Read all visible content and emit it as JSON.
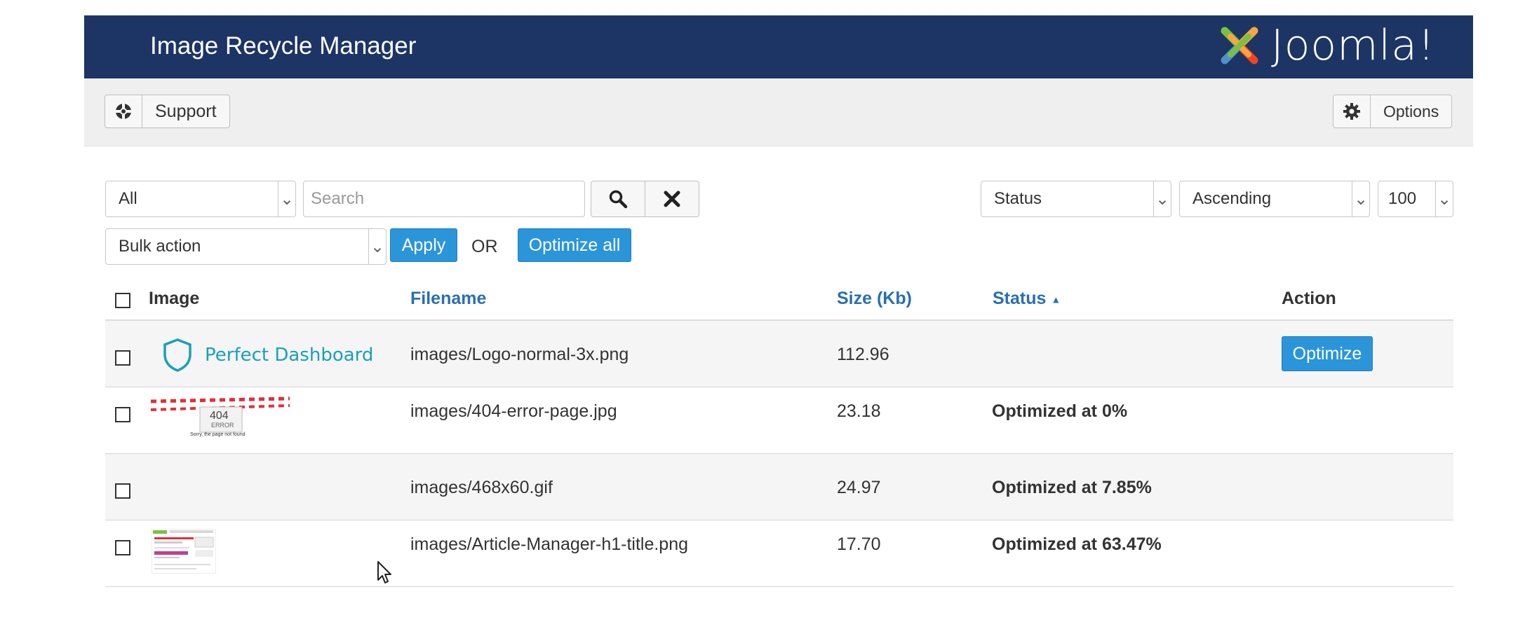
{
  "header": {
    "title": "Image Recycle Manager",
    "brand": "Joomla!"
  },
  "toolbar": {
    "support_label": "Support",
    "options_label": "Options"
  },
  "filters": {
    "type_select": "All",
    "search_placeholder": "Search",
    "sort_field": "Status",
    "sort_order": "Ascending",
    "page_size": "100"
  },
  "bulk": {
    "select": "Bulk action",
    "apply": "Apply",
    "or": "OR",
    "optimize_all": "Optimize all"
  },
  "table": {
    "columns": {
      "image": "Image",
      "filename": "Filename",
      "size": "Size (Kb)",
      "status": "Status",
      "action": "Action"
    },
    "rows": [
      {
        "thumb_text": "Perfect Dashboard",
        "filename": "images/Logo-normal-3x.png",
        "size": "112.96",
        "status": "",
        "action": "Optimize"
      },
      {
        "thumb_text": "404",
        "thumb_sub": "ERROR",
        "thumb_caption": "Sorry, the page not found",
        "filename": "images/404-error-page.jpg",
        "size": "23.18",
        "status": "Optimized at 0%",
        "action": ""
      },
      {
        "filename": "images/468x60.gif",
        "size": "24.97",
        "status": "Optimized at 7.85%",
        "action": ""
      },
      {
        "filename": "images/Article-Manager-h1-title.png",
        "size": "17.70",
        "status": "Optimized at 63.47%",
        "action": ""
      }
    ]
  },
  "colors": {
    "header_bg": "#1c3564",
    "accent": "#2b95d9",
    "link": "#2a6fb3",
    "perfect_dashboard": "#1aa0b8"
  }
}
